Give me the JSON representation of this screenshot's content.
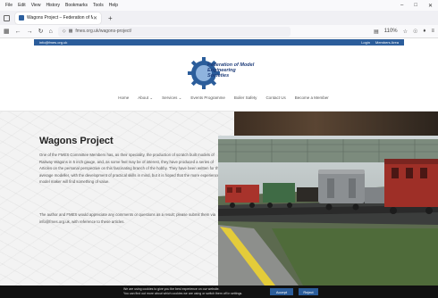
{
  "browser": {
    "menu": [
      "File",
      "Edit",
      "View",
      "History",
      "Bookmarks",
      "Tools",
      "Help"
    ],
    "tab_title": "Wagons Project – Federation of M",
    "url": "fmes.org.uk/wagons-project/",
    "zoom": "110%"
  },
  "site": {
    "top_email": "info@fmes.org.uk",
    "top_links": [
      "Login",
      "Members Area"
    ],
    "logo_text": [
      "Federation of Model",
      "Engineering Societies"
    ],
    "nav": [
      "Home",
      "About",
      "Services",
      "Events Programme",
      "Boiler Safety",
      "Contact Us",
      "Become a Member"
    ]
  },
  "page": {
    "title": "Wagons Project",
    "para1": "One of the FMES Committee Members has, as their speciality, the production of scratch built models of Railway Wagons in 5 inch gauge, and, as some feel may be of interest, they have produced a series of Articles on the personal perspective on this fascinating branch of the hobby. They have been written for the average modeller, with the development of practical skills in mind, but it is hoped that the more experienced model maker will find something of value.",
    "para2": "The author and FMES would appreciate any comments or questions as a result; please submit them via info@fmes.org.uk, with reference to these articles."
  },
  "cookie": {
    "line1": "We are using cookies to give you the best experience on our website.",
    "line2": "You can find out more about which cookies we are using or switch them off in settings.",
    "accept": "Accept",
    "reject": "Reject"
  },
  "colors": {
    "brand": "#2b5d9b",
    "cookie_bg": "#111111"
  }
}
